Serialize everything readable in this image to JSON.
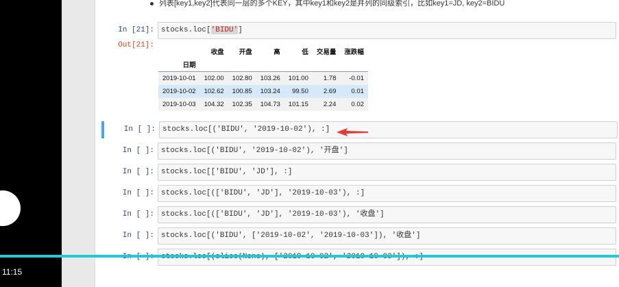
{
  "player": {
    "time": "11:15",
    "progress": 1.0
  },
  "markdown": {
    "text": "列表[key1,key2]代表同一层的多个KEY，其中key1和key2是并列的同级索引，比如key1=JD, key2=BIDU"
  },
  "cell21": {
    "prompt": "In [21]:",
    "code_prefix": "stocks.loc[",
    "code_str": "'BIDU'",
    "code_suffix": "]",
    "out_prompt": "Out[21]:"
  },
  "dataframe": {
    "columns": [
      "收盘",
      "开盘",
      "高",
      "低",
      "交易量",
      "涨跌幅"
    ],
    "index_name": "日期",
    "rows": [
      {
        "date": "2019-10-01",
        "values": [
          "102.00",
          "102.80",
          "103.26",
          "101.00",
          "1.78",
          "-0.01"
        ]
      },
      {
        "date": "2019-10-02",
        "values": [
          "102.62",
          "100.85",
          "103.24",
          "99.50",
          "2.69",
          "0.01"
        ]
      },
      {
        "date": "2019-10-03",
        "values": [
          "104.32",
          "102.35",
          "104.73",
          "101.15",
          "2.24",
          "0.02"
        ]
      }
    ]
  },
  "cells": [
    {
      "prompt": "In [ ]:",
      "code": "stocks.loc[('BIDU', '2019-10-02'), :]"
    },
    {
      "prompt": "In [ ]:",
      "code": "stocks.loc[('BIDU', '2019-10-02'), '开盘']"
    },
    {
      "prompt": "In [ ]:",
      "code": "stocks.loc[['BIDU', 'JD'], :]"
    },
    {
      "prompt": "In [ ]:",
      "code": "stocks.loc[(['BIDU', 'JD'], '2019-10-03'), :]"
    },
    {
      "prompt": "In [ ]:",
      "code": "stocks.loc[(['BIDU', 'JD'], '2019-10-03'), '收盘']"
    },
    {
      "prompt": "In [ ]:",
      "code": "stocks.loc[('BIDU', ['2019-10-02', '2019-10-03']), '收盘']"
    },
    {
      "prompt": "In [ ]:",
      "code": "stocks.loc[(slice(None), ['2019-10-02', '2019-10-03']), :]"
    }
  ],
  "colors": {
    "selected_border": "#42a5f5",
    "progress": "#26c6da",
    "arrow": "#e53935",
    "string": "#ba2121"
  }
}
